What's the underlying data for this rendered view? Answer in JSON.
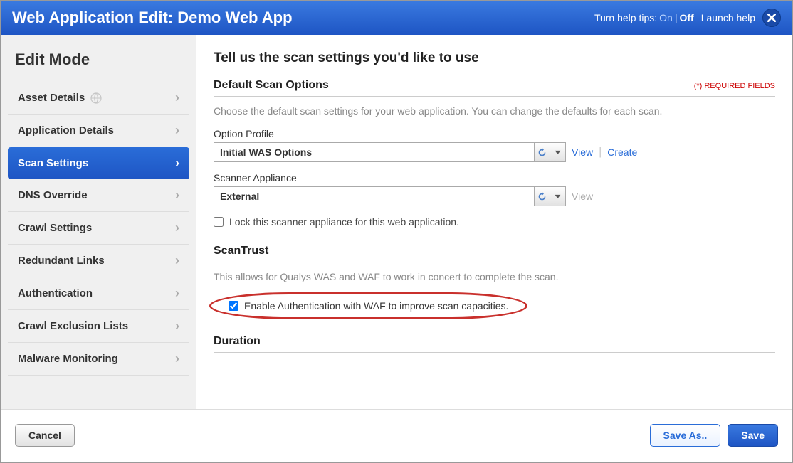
{
  "header": {
    "title": "Web Application Edit: Demo Web App",
    "help_tips_label": "Turn help tips:",
    "help_on": "On",
    "help_off": "Off",
    "launch_help": "Launch help"
  },
  "sidebar": {
    "title": "Edit Mode",
    "items": [
      {
        "label": "Asset Details",
        "has_globe": true
      },
      {
        "label": "Application Details"
      },
      {
        "label": "Scan Settings",
        "active": true
      },
      {
        "label": "DNS Override"
      },
      {
        "label": "Crawl Settings"
      },
      {
        "label": "Redundant Links"
      },
      {
        "label": "Authentication"
      },
      {
        "label": "Crawl Exclusion Lists"
      },
      {
        "label": "Malware Monitoring"
      }
    ]
  },
  "main": {
    "heading": "Tell us the scan settings you'd like to use",
    "default_scan": {
      "title": "Default Scan Options",
      "required_note": "(*) REQUIRED FIELDS",
      "desc": "Choose the default scan settings for your web application. You can change the defaults for each scan.",
      "option_profile_label": "Option Profile",
      "option_profile_value": "Initial WAS Options",
      "view_link": "View",
      "create_link": "Create",
      "scanner_label": "Scanner Appliance",
      "scanner_value": "External",
      "lock_label": "Lock this scanner appliance for this web application."
    },
    "scantrust": {
      "title": "ScanTrust",
      "desc": "This allows for Qualys WAS and WAF to work in concert to complete the scan.",
      "enable_label": "Enable Authentication with WAF to improve scan capacities."
    },
    "duration": {
      "title": "Duration"
    }
  },
  "footer": {
    "cancel": "Cancel",
    "save_as": "Save As..",
    "save": "Save"
  }
}
